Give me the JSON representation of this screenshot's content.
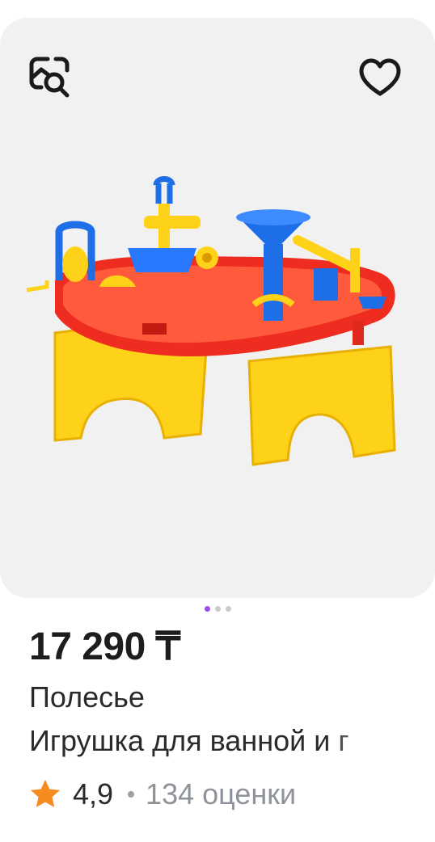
{
  "icons": {
    "search": "image-search-icon",
    "favorite": "heart-icon",
    "rating": "star-icon"
  },
  "carousel": {
    "count": 3,
    "active_index": 0
  },
  "product": {
    "price": "17 290 ₸",
    "brand": "Полесье",
    "title": "Игрушка для ванной и г",
    "rating": "4,9",
    "reviews": "134 оценки"
  },
  "colors": {
    "accent": "#a24cf0",
    "star": "#f58a1f",
    "muted_text": "#8e939a",
    "image_background": "#f1f1f1"
  }
}
